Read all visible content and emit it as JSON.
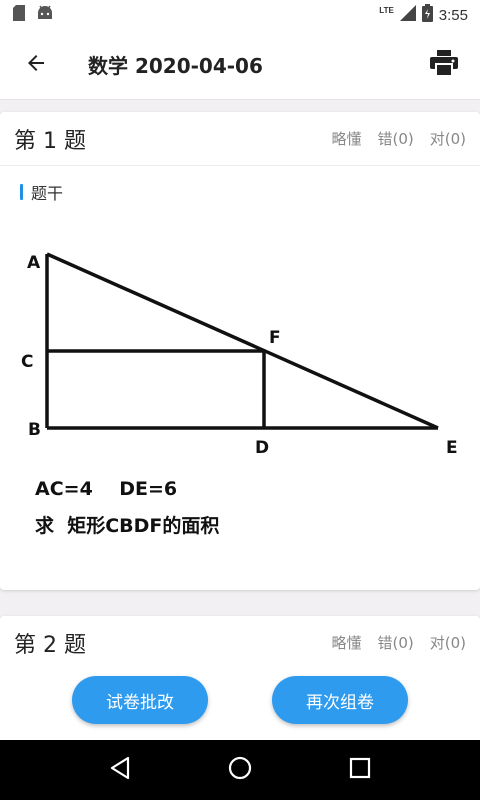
{
  "status_bar": {
    "network": "LTE",
    "time": "3:55"
  },
  "app_bar": {
    "title": "数学 2020-04-06"
  },
  "questions": [
    {
      "title": "第 1 题",
      "actions": {
        "skim": "略懂",
        "wrong": "错(0)",
        "right": "对(0)"
      },
      "stem_label": "题干",
      "figure": {
        "points": {
          "A": "A",
          "B": "B",
          "C": "C",
          "D": "D",
          "E": "E",
          "F": "F"
        },
        "given": "AC=4    DE=6",
        "question": "求  矩形CBDF的面积"
      }
    },
    {
      "title": "第 2 题",
      "actions": {
        "skim": "略懂",
        "wrong": "错(0)",
        "right": "对(0)"
      }
    }
  ],
  "bottom_buttons": {
    "grade": "试卷批改",
    "regenerate": "再次组卷"
  },
  "colors": {
    "accent": "#2e9bef",
    "stem_bar": "#1e90e6"
  }
}
